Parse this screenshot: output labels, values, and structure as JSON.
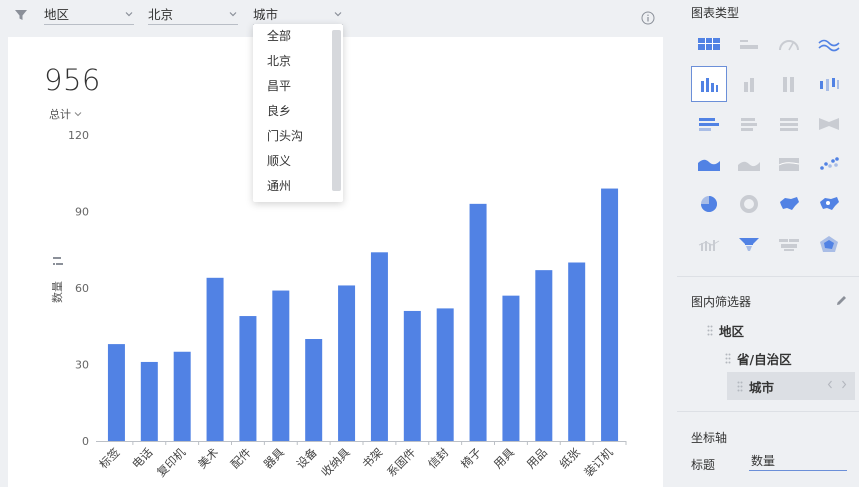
{
  "filters": {
    "region": "地区",
    "province": "北京",
    "city": "城市"
  },
  "dropdown": {
    "options": [
      "全部",
      "北京",
      "昌平",
      "良乡",
      "门头沟",
      "顺义",
      "通州"
    ]
  },
  "kpi": {
    "value": "956",
    "label": "总计"
  },
  "colors": {
    "bar": "#5182e4",
    "accent": "#6b8fd8"
  },
  "chart_data": {
    "type": "bar",
    "categories": [
      "标签",
      "电话",
      "复印机",
      "美术",
      "配件",
      "器具",
      "设备",
      "收纳具",
      "书架",
      "系固件",
      "信封",
      "椅子",
      "用具",
      "用品",
      "纸张",
      "装订机"
    ],
    "values": [
      38,
      31,
      35,
      64,
      49,
      59,
      40,
      61,
      74,
      51,
      52,
      93,
      57,
      67,
      70,
      99
    ],
    "ylabel": "数量",
    "ylim": [
      0,
      120
    ],
    "yticks": [
      0,
      30,
      60,
      90,
      120
    ],
    "grid": false
  },
  "panel": {
    "chart_type_title": "图表类型",
    "chart_types": [
      "table-icon",
      "kpi-card-icon",
      "gauge-icon",
      "wave-line-icon",
      "bar-chart-icon",
      "stacked-bar-icon",
      "percent-bar-icon",
      "range-bar-icon",
      "hbar-chart-icon",
      "stacked-hbar-icon",
      "percent-hbar-icon",
      "funnel-bar-icon",
      "area-chart-icon",
      "stacked-area-icon",
      "percent-area-icon",
      "scatter-icon",
      "pie-icon",
      "donut-icon",
      "china-map-icon",
      "heat-map-icon",
      "combo-icon",
      "funnel-icon",
      "word-cloud-icon",
      "radar-icon"
    ],
    "filter_title": "图内筛选器",
    "tree": [
      "地区",
      "省/自治区",
      "城市"
    ],
    "axis_title": "坐标轴",
    "axis_field_label": "标题",
    "axis_field_value": "数量"
  }
}
